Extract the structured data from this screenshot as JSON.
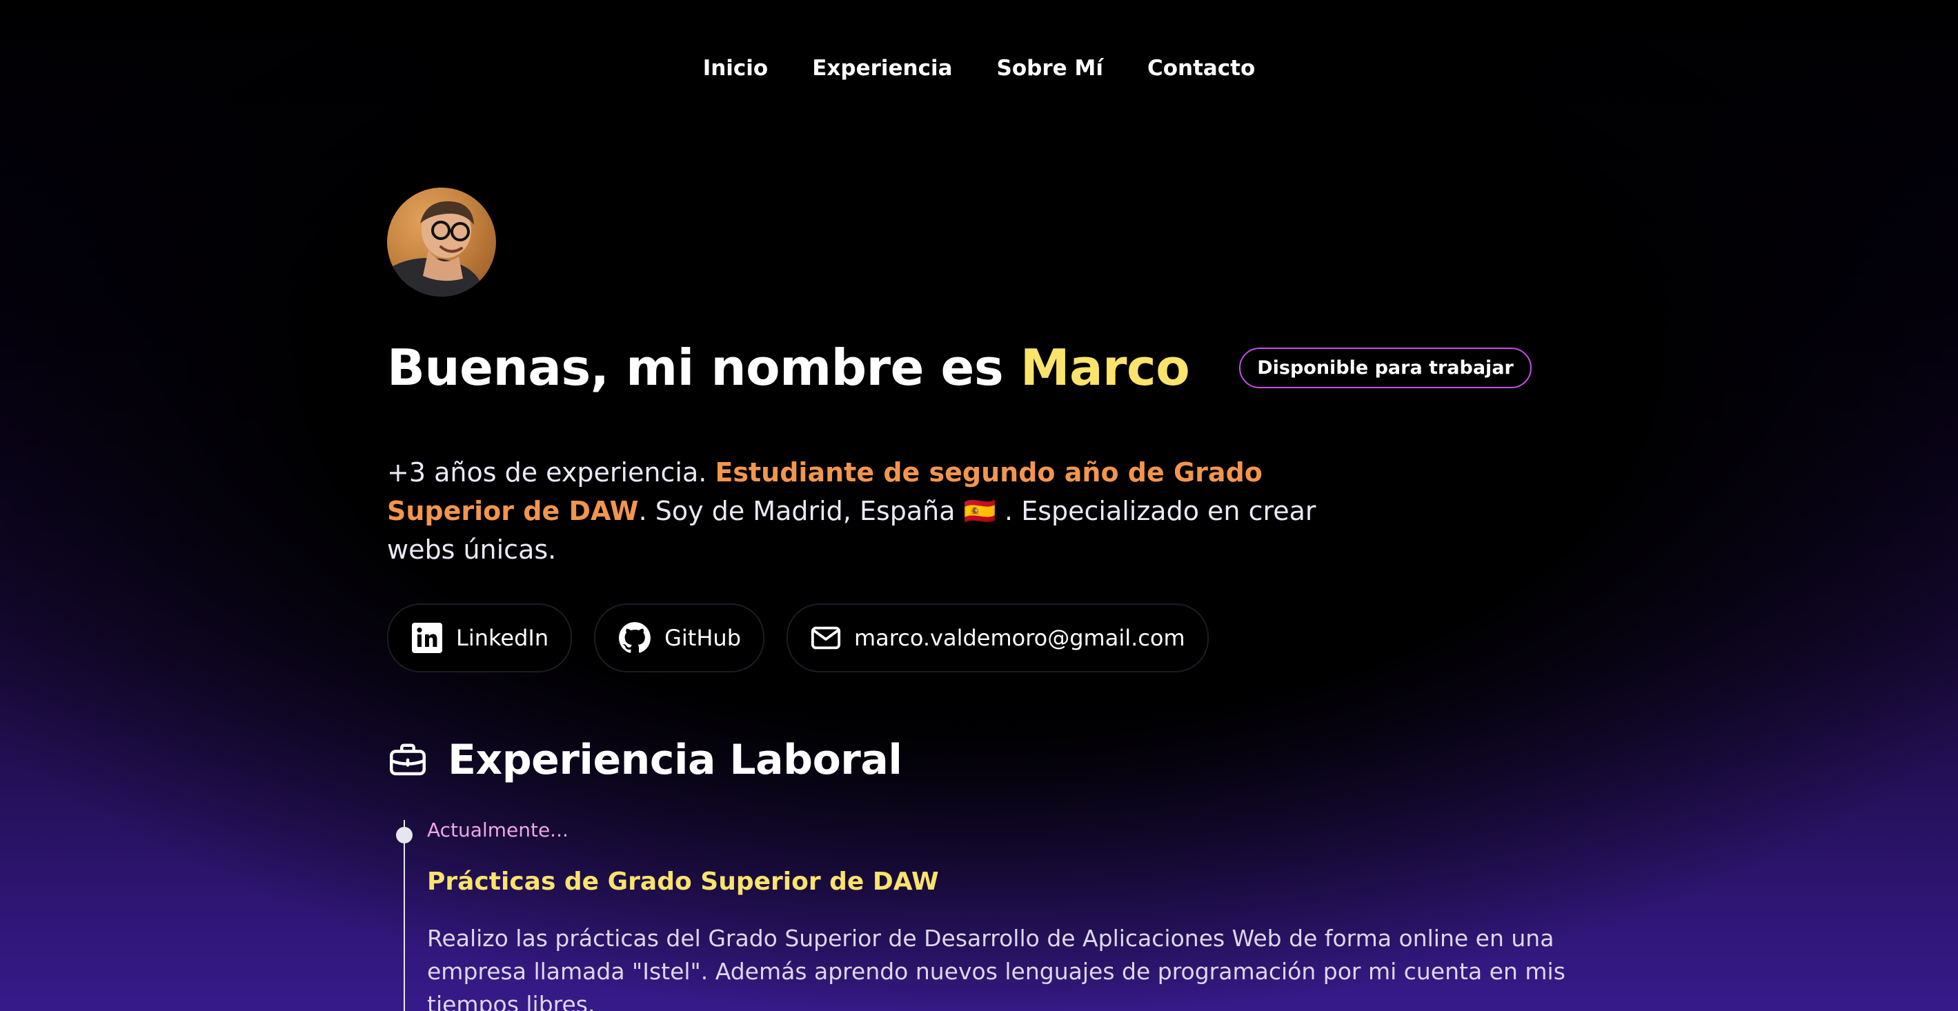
{
  "nav": {
    "items": [
      "Inicio",
      "Experiencia",
      "Sobre Mí",
      "Contacto"
    ]
  },
  "hero": {
    "avatar_alt": "Foto de perfil de Marco",
    "title_prefix": "Buenas, mi nombre es",
    "title_name": "Marco",
    "badge": "Disponible para trabajar",
    "bio_intro": "+3 años de experiencia.",
    "bio_highlight": "Estudiante de segundo año de Grado Superior de DAW",
    "bio_location": ". Soy de Madrid, España",
    "bio_flag": "🇪🇸",
    "bio_end": " . Especializado en crear webs únicas."
  },
  "socials": [
    {
      "label": "LinkedIn",
      "icon": "linkedin-icon"
    },
    {
      "label": "GitHub",
      "icon": "github-icon"
    },
    {
      "label": "marco.valdemoro@gmail.com",
      "icon": "mail-icon"
    }
  ],
  "experience": {
    "title": "Experiencia Laboral",
    "icon": "briefcase-icon",
    "items": [
      {
        "date": "Actualmente...",
        "role": "Prácticas de Grado Superior de DAW",
        "description": "Realizo las prácticas del Grado Superior de Desarrollo de Aplicaciones Web de forma online en una empresa llamada \"Istel\". Además aprendo nuevos lenguajes de programación por mi cuenta en mis tiempos libres."
      }
    ]
  },
  "colors": {
    "name_accent": "#fce36b",
    "bio_highlight": "#f2964d",
    "badge_border": "#c64fe4",
    "date_accent": "#f0a6e6",
    "background_bottom": "#371a8a"
  }
}
